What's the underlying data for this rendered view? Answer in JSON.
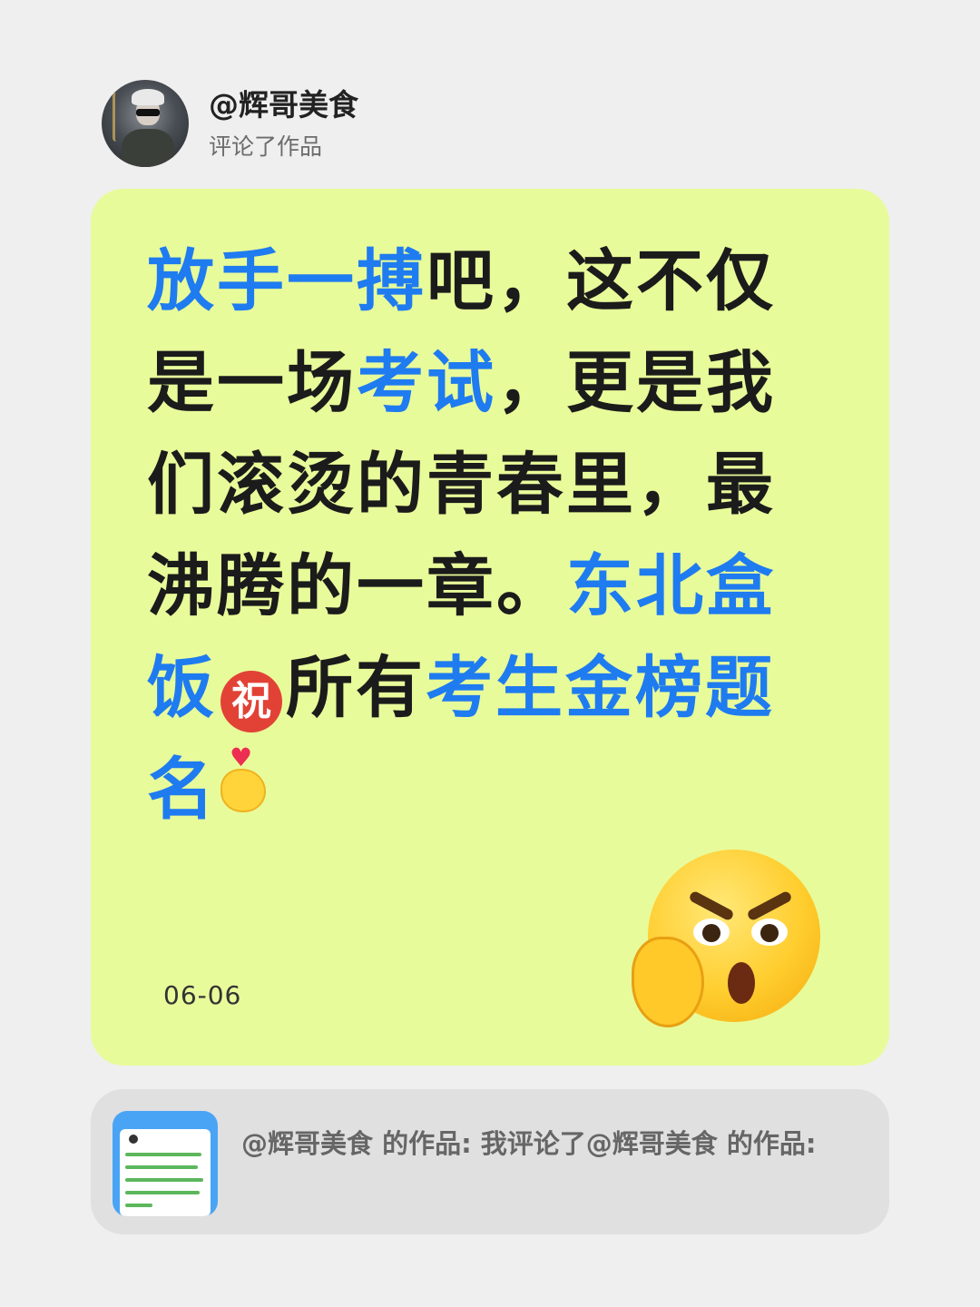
{
  "header": {
    "username": "@辉哥美食",
    "subtitle": "评论了作品"
  },
  "comment": {
    "segments": [
      {
        "text": "放手一搏",
        "highlight": true
      },
      {
        "text": "吧，这不仅是一场",
        "highlight": false
      },
      {
        "text": "考试",
        "highlight": true
      },
      {
        "text": "，更是我们滚烫的青春里，最沸腾的一章。",
        "highlight": false
      },
      {
        "text": "东北盒饭",
        "highlight": true
      },
      {
        "text": "祝",
        "highlight": false
      },
      {
        "text": "所有",
        "highlight": false
      },
      {
        "text": "考生金榜题名",
        "highlight": true
      }
    ],
    "date": "06-06"
  },
  "shared": {
    "text": "@辉哥美食 的作品: 我评论了@辉哥美食 的作品:"
  },
  "icons": {
    "avatar": "user-avatar",
    "zhu": "congratulation-emoji",
    "finger_heart": "finger-heart-emoji",
    "angry": "angry-thinking-emoji",
    "thumbnail": "post-thumbnail"
  },
  "colors": {
    "background": "#efefef",
    "card": "#e8fb9a",
    "highlight": "#1f7bf0",
    "shared_card": "#e0e0e0"
  }
}
